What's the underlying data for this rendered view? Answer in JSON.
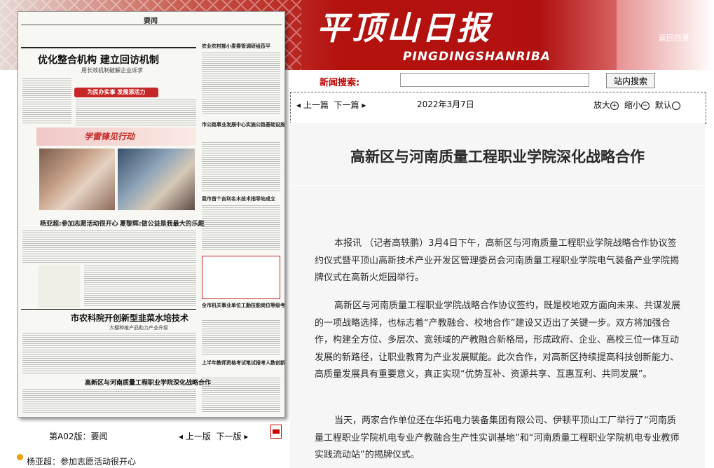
{
  "header": {
    "logo_cn": "平顶山日报",
    "logo_en": "PINGDINGSHANRIBA",
    "top_link": "返回目录"
  },
  "search": {
    "label": "新闻搜索:",
    "value": "",
    "button_label": "站内搜索"
  },
  "toolbar": {
    "prev_label": "上一篇",
    "next_label": "下一篇",
    "date": "2022年3月7日",
    "zoom_in": "放大",
    "zoom_out": "缩小",
    "zoom_default": "默认"
  },
  "paper_page": {
    "section": "要闻",
    "headline_main": "优化整合机构 建立回访机制",
    "sub_main": "用长效机制破解企业诉求",
    "tag": "为民办实事 发展添活力",
    "banner": "学雷锋见行动",
    "photo_caption_left": "杨亚超:参加志愿活动很开心",
    "photo_caption_right": "夏黎辉:做公益是我最大的乐趣",
    "headline_lower": "市农科院开创新型韭菜水培技术",
    "sub_lower": "大棚种植产品助力产业升级",
    "headline_bottom": "高新区与河南质量工程职业学院深化战略合作",
    "right_heads": [
      "农业农村部小麦春管调研组莅平",
      "市公路事业发展中心实施公路基础设施建设大会战",
      "我市首个吉利名木技术指导站成立",
      "全市机关事业单位工勤技能岗位等级考核启动",
      "上半年教师资格考试笔试报考人数创新高"
    ]
  },
  "page_footer": {
    "edition": "第A02版：要闻",
    "prev_page": "上一版",
    "next_page": "下一版",
    "pdf_icon": "pdf-icon"
  },
  "article_list": [
    {
      "title": "杨亚超：参加志愿活动很开心"
    }
  ],
  "article": {
    "title": "高新区与河南质量工程职业学院深化战略合作",
    "paragraphs": [
      "本报讯 （记者高轶鹏）3月4日下午，高新区与河南质量工程职业学院战略合作协议签约仪式暨平顶山高新技术产业开发区管理委员会河南质量工程职业学院电气装备产业学院揭牌仪式在高新火炬园举行。",
      "高新区与河南质量工程职业学院战略合作协议签约，既是校地双方面向未来、共谋发展的一项战略选择，也标志着“产教融合、校地合作”建设又迈出了关键一步。双方将加强合作，构建全方位、多层次、宽领域的产教融合新格局，形成政府、企业、高校三位一体互动发展的新路径，让职业教育为产业发展赋能。此次合作，对高新区持续提高科技创新能力、高质量发展具有重要意义，真正实现“优势互补、资源共享、互惠互利、共同发展”。",
      "当天，两家合作单位还在华拓电力装备集团有限公司、伊顿平顶山工厂举行了“河南质量工程职业学院机电专业产教融合生产性实训基地”和“河南质量工程职业学院机电专业教师实践流动站”的揭牌仪式。"
    ]
  },
  "colors": {
    "brand_red": "#b01010",
    "search_label": "#c00000"
  }
}
